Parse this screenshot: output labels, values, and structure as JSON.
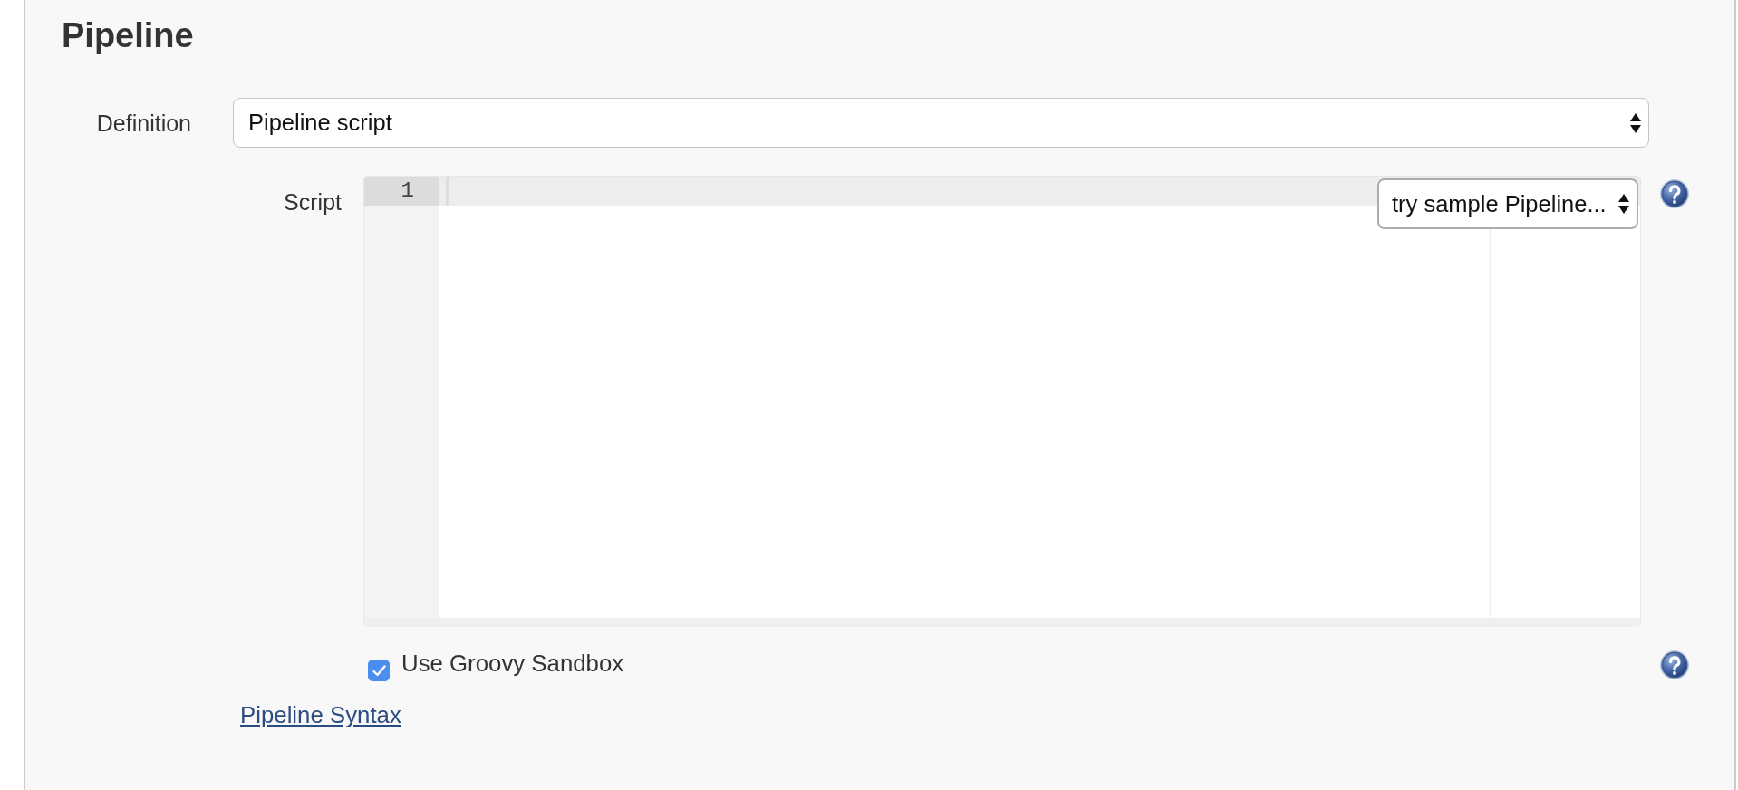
{
  "section": {
    "title": "Pipeline"
  },
  "definition": {
    "label": "Definition",
    "value": "Pipeline script"
  },
  "script": {
    "label": "Script",
    "lines": [
      {
        "number": "1",
        "active": true
      }
    ],
    "sample_select": {
      "value": "try sample Pipeline..."
    }
  },
  "sandbox": {
    "label": "Use Groovy Sandbox",
    "checked": true
  },
  "link": "Pipeline Syntax"
}
